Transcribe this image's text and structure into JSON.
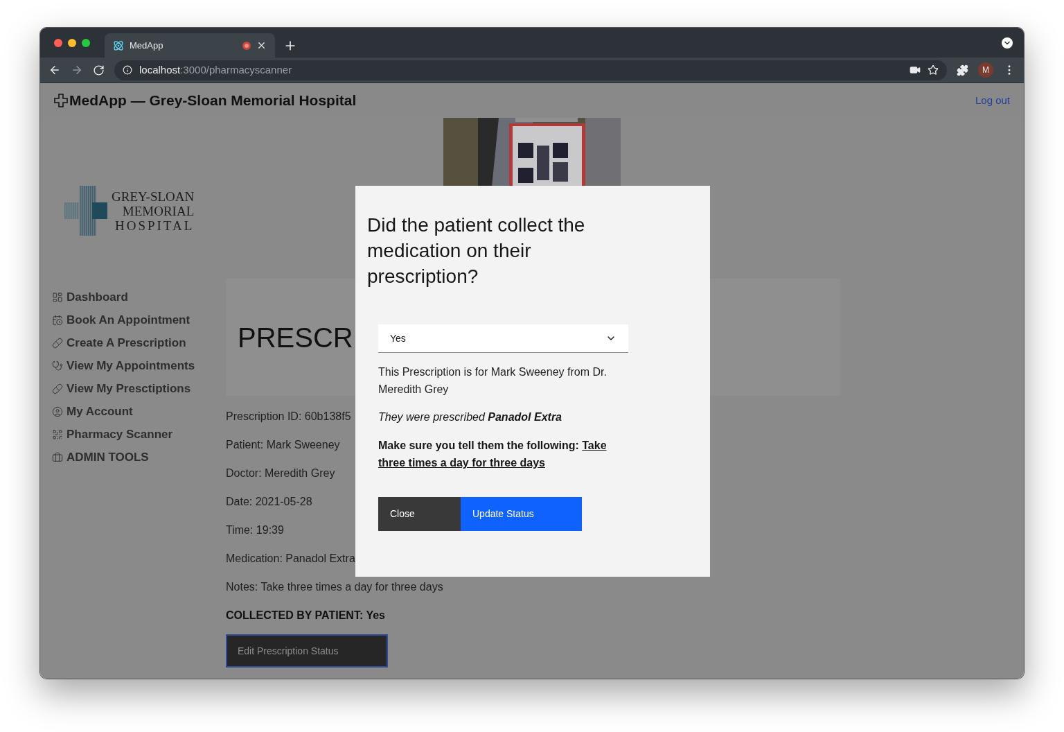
{
  "browser": {
    "tab": {
      "title": "MedApp",
      "recording": true
    },
    "url": {
      "host": "localhost",
      "path": ":3000/pharmacyscanner"
    },
    "profile_initial": "M"
  },
  "header": {
    "title": "MedApp — Grey-Sloan Memorial Hospital",
    "logout": "Log out"
  },
  "logo": {
    "lines": [
      "GREY-SLOAN",
      "MEMORIAL",
      "HOSPITAL"
    ]
  },
  "sidebar": {
    "items": [
      {
        "label": "Dashboard",
        "kind": "dashboard"
      },
      {
        "label": "Book An Appointment",
        "kind": "calendar"
      },
      {
        "label": "Create A Prescription",
        "kind": "pill"
      },
      {
        "label": "View My Appointments",
        "kind": "stethoscope"
      },
      {
        "label": "View My Presctiptions",
        "kind": "pill"
      },
      {
        "label": "My Account",
        "kind": "account"
      },
      {
        "label": "Pharmacy Scanner",
        "kind": "qr"
      },
      {
        "label": "ADMIN TOOLS",
        "kind": "briefcase"
      }
    ]
  },
  "page": {
    "heading": "PRESCR",
    "details": [
      "Prescription ID: 60b138f5",
      "Patient: Mark Sweeney",
      "Doctor: Meredith Grey",
      "Date: 2021-05-28",
      "Time: 19:39",
      "Medication: Panadol Extra",
      "Notes: Take three times a day for three days"
    ],
    "status": "COLLECTED BY PATIENT: Yes",
    "edit_button": "Edit Prescription Status"
  },
  "modal": {
    "question": "Did the patient collect the medication on their prescription?",
    "select": {
      "value": "Yes"
    },
    "summary": "This Prescription is for Mark Sweeney from Dr. Meredith Grey",
    "prescribed": "They were prescribed **Panadol Extra**",
    "instruction_label": "Make sure you tell them the following:",
    "instruction": "Take three times a day for three days",
    "buttons": [
      {
        "label": "Close",
        "kind": "secondary"
      },
      {
        "label": "Update Status",
        "kind": "primary"
      }
    ]
  }
}
